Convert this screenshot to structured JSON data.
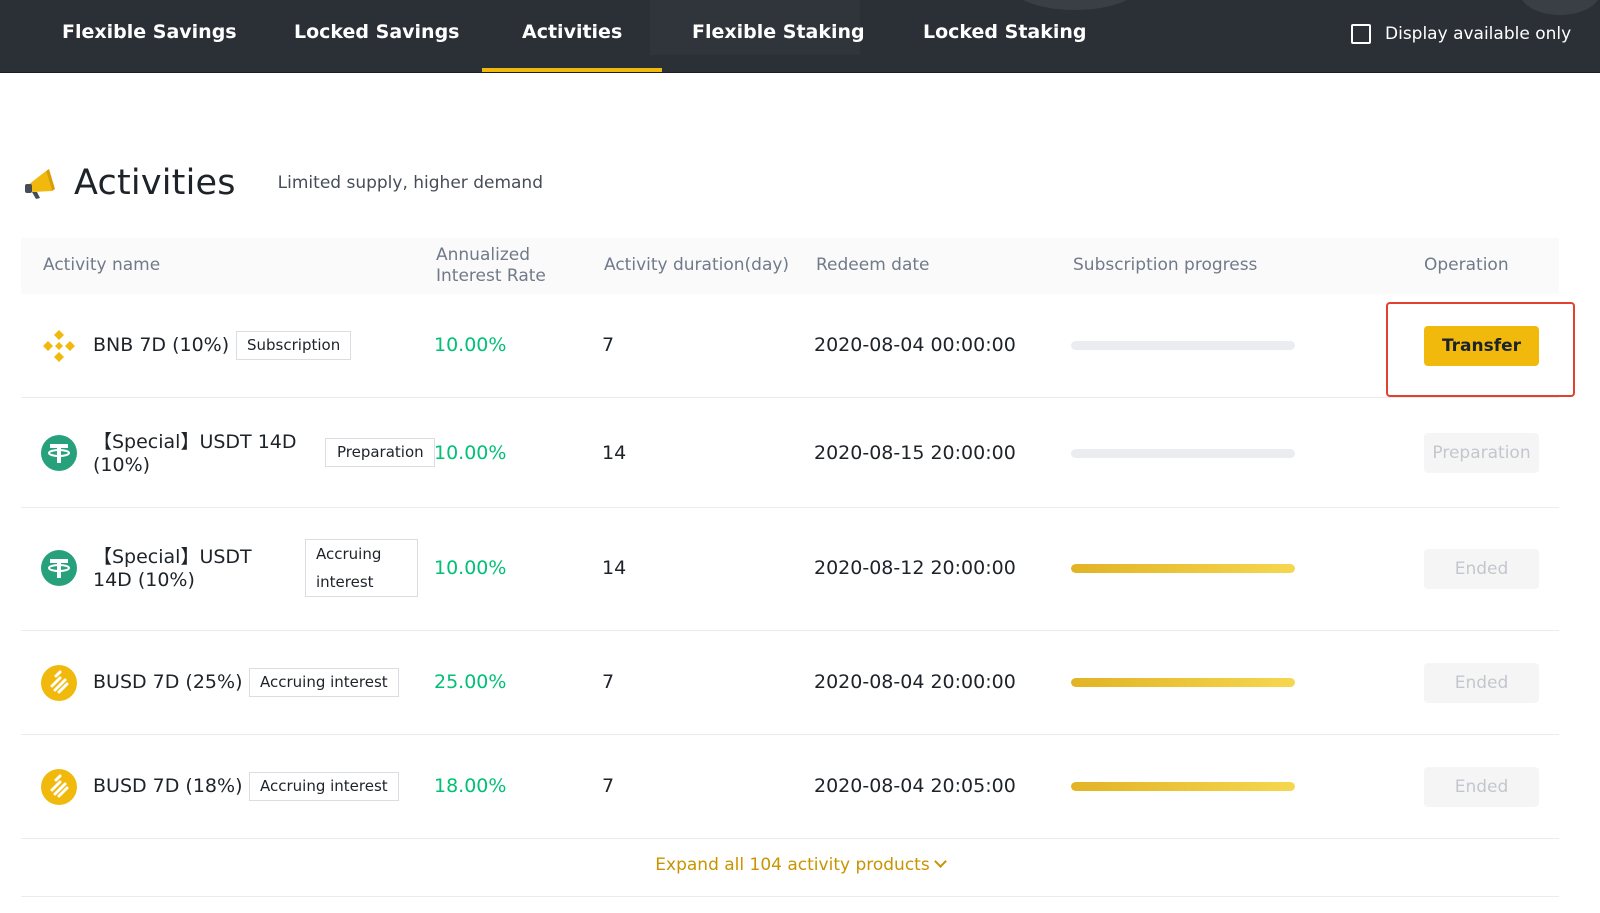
{
  "nav": {
    "tabs": [
      {
        "label": "Flexible Savings"
      },
      {
        "label": "Locked Savings"
      },
      {
        "label": "Activities",
        "active": true
      },
      {
        "label": "Flexible Staking"
      },
      {
        "label": "Locked Staking"
      }
    ],
    "display_available_label": "Display available only",
    "display_available_checked": false
  },
  "section": {
    "icon": "megaphone-icon",
    "title": "Activities",
    "subtitle": "Limited supply, higher demand"
  },
  "table": {
    "columns": {
      "name": "Activity name",
      "rate": "Annualized Interest Rate",
      "duration": "Activity duration(day)",
      "redeem": "Redeem date",
      "progress": "Subscription progress",
      "operation": "Operation"
    },
    "rows": [
      {
        "coin_icon": "bnb-icon",
        "name": "BNB 7D (10%)",
        "status": "Subscription",
        "rate": "10.00%",
        "duration": "7",
        "redeem_date": "2020-08-04 00:00:00",
        "progress": 0,
        "operation": "Transfer",
        "operation_enabled": true
      },
      {
        "coin_icon": "usdt-icon",
        "name": "【Special】USDT 14D (10%)",
        "status": "Preparation",
        "rate": "10.00%",
        "duration": "14",
        "redeem_date": "2020-08-15 20:00:00",
        "progress": 0,
        "operation": "Preparation",
        "operation_enabled": false
      },
      {
        "coin_icon": "usdt-icon",
        "name": "【Special】USDT 14D (10%)",
        "status": "Accruing interest",
        "rate": "10.00%",
        "duration": "14",
        "redeem_date": "2020-08-12 20:00:00",
        "progress": 1,
        "operation": "Ended",
        "operation_enabled": false
      },
      {
        "coin_icon": "busd-icon",
        "name": "BUSD 7D (25%)",
        "status": "Accruing interest",
        "rate": "25.00%",
        "duration": "7",
        "redeem_date": "2020-08-04 20:00:00",
        "progress": 1,
        "operation": "Ended",
        "operation_enabled": false
      },
      {
        "coin_icon": "busd-icon",
        "name": "BUSD 7D (18%)",
        "status": "Accruing interest",
        "rate": "18.00%",
        "duration": "7",
        "redeem_date": "2020-08-04 20:05:00",
        "progress": 1,
        "operation": "Ended",
        "operation_enabled": false
      }
    ]
  },
  "expand_label": "Expand all 104 activity products",
  "colors": {
    "accent": "#f0b90b",
    "rate_green": "#02c076",
    "highlight_red": "#e1412d",
    "nav_bg": "#2b2f36"
  }
}
